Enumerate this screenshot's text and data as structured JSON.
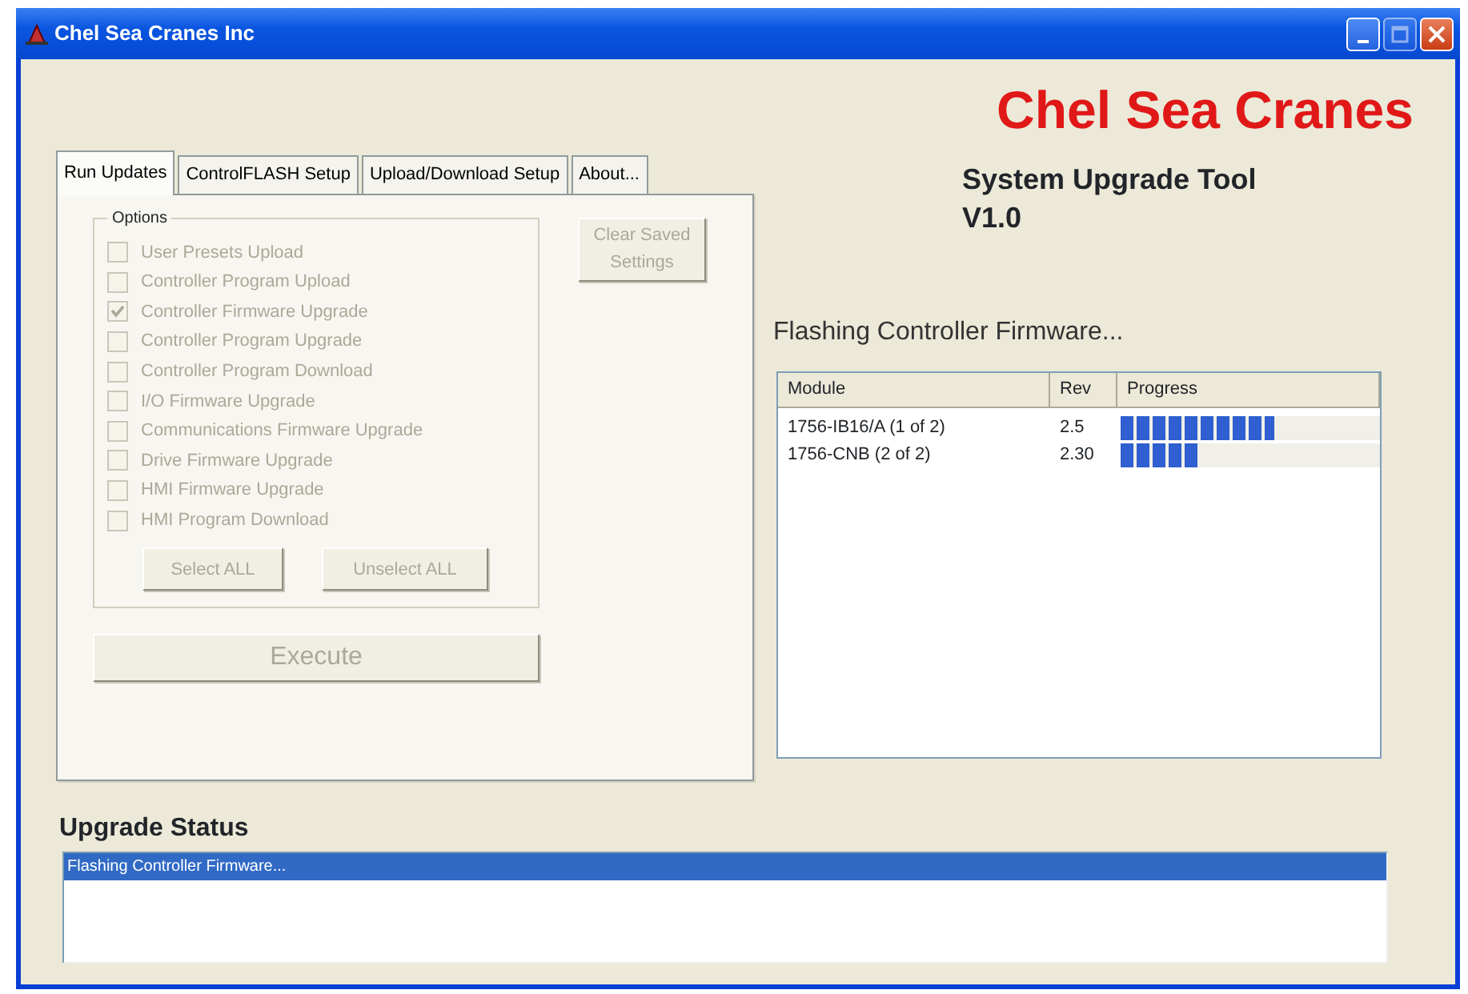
{
  "window": {
    "title": "Chel Sea Cranes Inc",
    "controls": [
      {
        "kind": "minimize",
        "disabled": false
      },
      {
        "kind": "maximize",
        "disabled": true
      },
      {
        "kind": "close",
        "disabled": false
      }
    ]
  },
  "brand": "Chel Sea Cranes",
  "tool_title": "System Upgrade Tool V1.0",
  "tabs": [
    {
      "label": "Run Updates",
      "selected": true
    },
    {
      "label": "ControlFLASH Setup",
      "selected": false
    },
    {
      "label": "Upload/Download Setup",
      "selected": false
    },
    {
      "label": "About...",
      "selected": false
    }
  ],
  "options": {
    "legend": "Options",
    "items": [
      {
        "label": "User Presets Upload",
        "checked": false,
        "disabled": true
      },
      {
        "label": "Controller Program Upload",
        "checked": false,
        "disabled": true
      },
      {
        "label": "Controller Firmware Upgrade",
        "checked": true,
        "disabled": true
      },
      {
        "label": "Controller Program Upgrade",
        "checked": false,
        "disabled": true
      },
      {
        "label": "Controller Program Download",
        "checked": false,
        "disabled": true
      },
      {
        "label": "I/O Firmware Upgrade",
        "checked": false,
        "disabled": true
      },
      {
        "label": "Communications Firmware Upgrade",
        "checked": false,
        "disabled": true
      },
      {
        "label": "Drive Firmware Upgrade",
        "checked": false,
        "disabled": true
      },
      {
        "label": "HMI Firmware Upgrade",
        "checked": false,
        "disabled": true
      },
      {
        "label": "HMI Program Download",
        "checked": false,
        "disabled": true
      }
    ],
    "buttons": [
      {
        "label": "Select ALL",
        "disabled": true
      },
      {
        "label": "Unselect ALL",
        "disabled": true
      }
    ]
  },
  "clear_button": {
    "label": "Clear Saved Settings",
    "disabled": true
  },
  "execute_button": {
    "label": "Execute",
    "disabled": true
  },
  "progress_label": "Flashing Controller Firmware...",
  "modules": {
    "columns": [
      "Module",
      "Rev",
      "Progress"
    ],
    "rows": [
      {
        "module": "1756-IB16/A (1 of 2)",
        "rev": "2.5",
        "level": 0.59
      },
      {
        "module": "1756-CNB (2 of 2)",
        "rev": "2.30",
        "level": 0.3
      }
    ]
  },
  "status": {
    "label": "Upgrade Status",
    "lines": [
      {
        "text": "Flashing Controller Firmware...",
        "selected": true
      }
    ]
  }
}
